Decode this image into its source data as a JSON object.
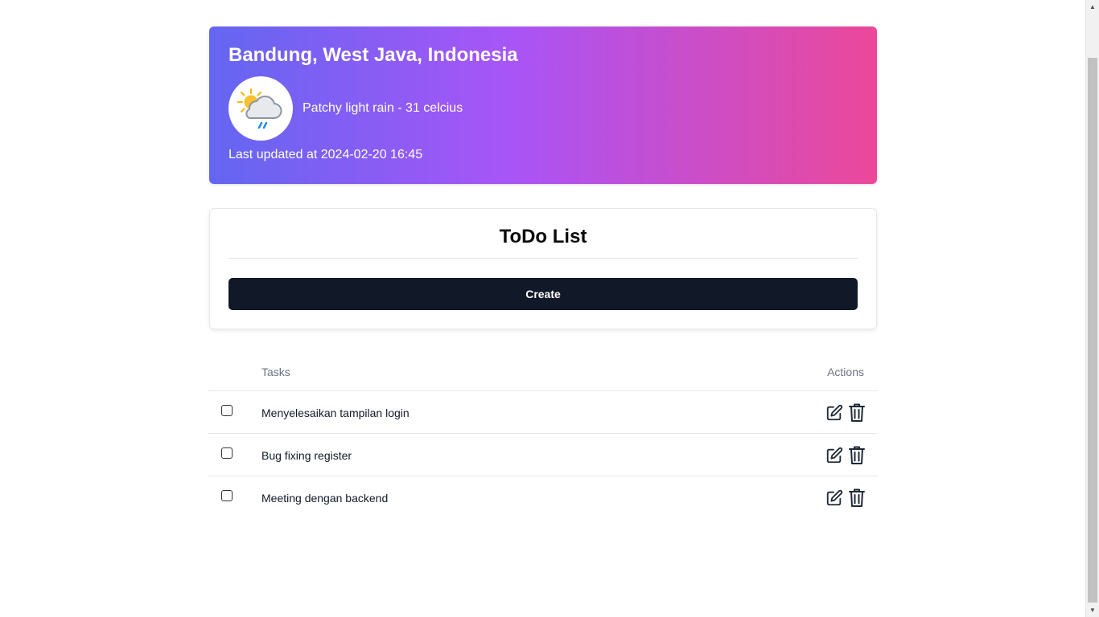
{
  "weather": {
    "location": "Bandung, West Java, Indonesia",
    "condition_text": "Patchy light rain - 31 celcius",
    "last_updated": "Last updated at 2024-02-20 16:45",
    "icon": "patchy-light-rain-icon",
    "gradient_colors": [
      "#6366f1",
      "#a855f7",
      "#ec4899"
    ]
  },
  "todo": {
    "title": "ToDo List",
    "create_label": "Create",
    "button_color": "#111827"
  },
  "table": {
    "columns": {
      "tasks": "Tasks",
      "actions": "Actions"
    },
    "rows": [
      {
        "label": "Menyelesaikan tampilan login",
        "checked": false
      },
      {
        "label": "Bug fixing register",
        "checked": false
      },
      {
        "label": "Meeting dengan backend",
        "checked": false
      }
    ],
    "row_actions": [
      "edit-icon",
      "trash-icon"
    ]
  }
}
